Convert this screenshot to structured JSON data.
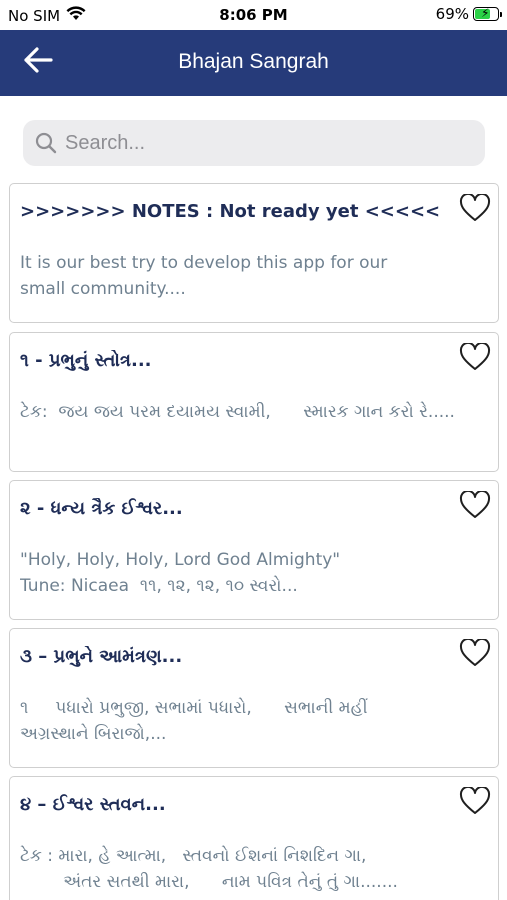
{
  "status_bar": {
    "carrier": "No SIM",
    "time": "8:06 PM",
    "battery_percent": "69%",
    "battery_level": 0.69
  },
  "nav": {
    "title": "Bhajan Sangrah",
    "back_icon": "arrow-left-icon"
  },
  "search": {
    "placeholder": "Search...",
    "value": ""
  },
  "items": [
    {
      "title": ">>>>>>> NOTES : Not ready yet <<<<<<",
      "lines": [
        "It is our best try to develop this app for our",
        "small community...."
      ]
    },
    {
      "title": "૧ - પ્રભુનું સ્તોત્ર...",
      "lines": [
        "ટેક:  જય જય પરમ દયામય સ્વામી,      સ્મારક ગાન કરો રે....."
      ]
    },
    {
      "title": "૨ - ધન્ય ત્રૈક ઈશ્વર...",
      "lines": [
        "\"Holy, Holy, Holy, Lord God Almighty\"",
        "Tune: Nicaea  ૧૧, ૧૨, ૧૨, ૧૦ સ્વરો..."
      ]
    },
    {
      "title": "૩ – પ્રભુને આમંત્રણ...",
      "lines": [
        "૧     પધારો પ્રભુજી, સભામાં પધારો,      સભાની મહીં",
        "અગ્રસ્થાને બિરાજો,..."
      ]
    },
    {
      "title": "૪ – ઈશ્વર સ્તવન...",
      "lines": [
        "ટેક : મારા, હે આત્મા,   સ્તવનો ઈશનાં નિશદિન ગા,",
        "        અંતર સતથી મારા,      નામ પવિત્ર તેનું તું ગા......."
      ]
    }
  ]
}
